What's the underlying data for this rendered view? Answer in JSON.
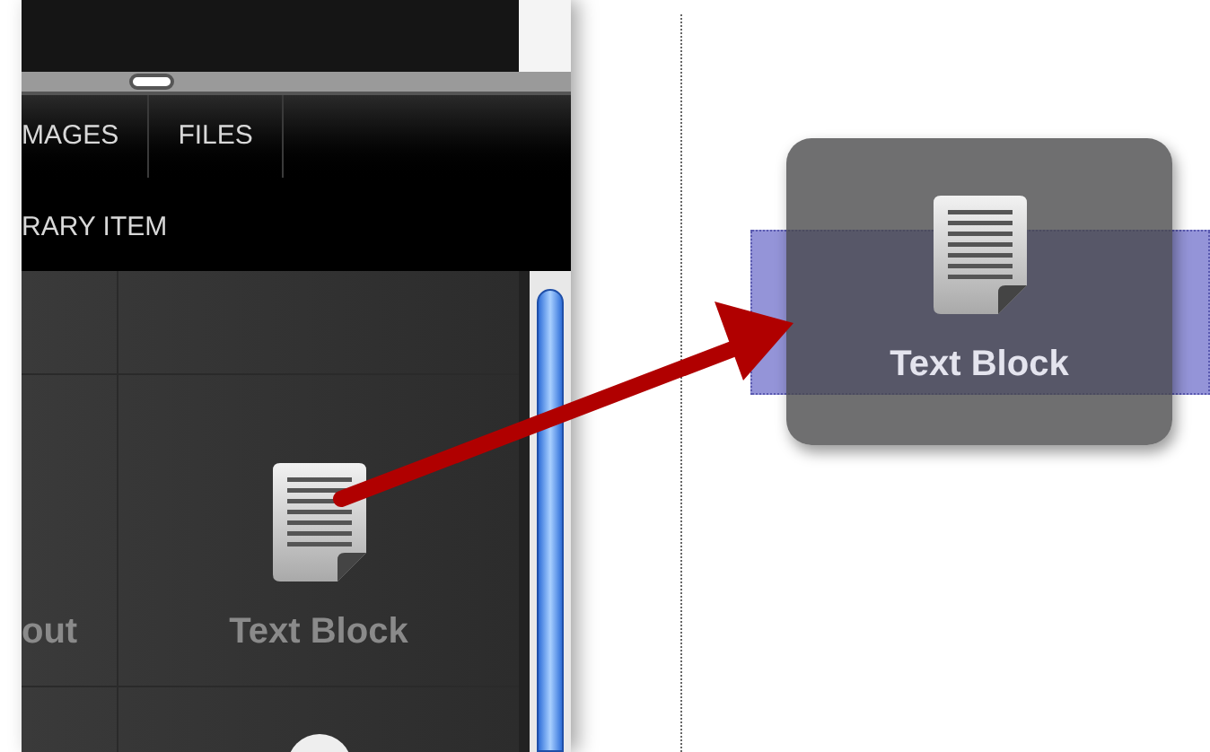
{
  "tabs": [
    {
      "label": "MAGES"
    },
    {
      "label": "FILES"
    }
  ],
  "section_header": "RARY ITEM",
  "tiles": [
    {
      "label": "out",
      "kind": "blank"
    },
    {
      "label": "Text Block",
      "kind": "document"
    }
  ],
  "drag_preview": {
    "label": "Text Block"
  }
}
